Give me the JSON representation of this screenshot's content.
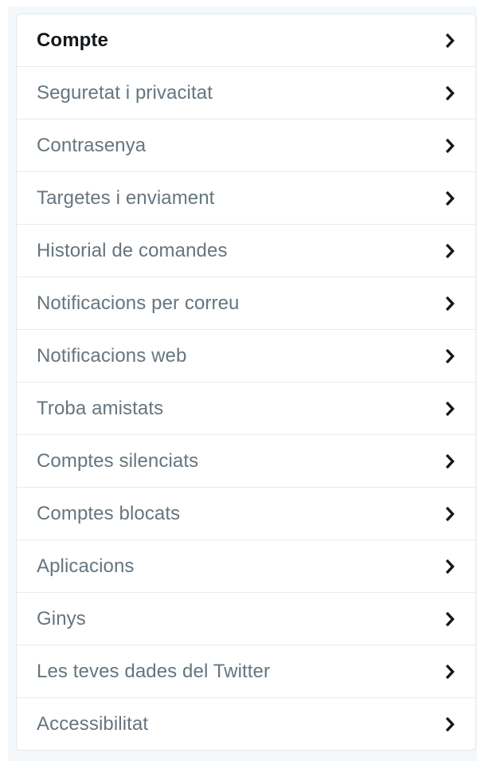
{
  "settings_menu": {
    "items": [
      {
        "label": "Compte",
        "active": true,
        "icon": "chevron-right-icon"
      },
      {
        "label": "Seguretat i privacitat",
        "active": false,
        "icon": "chevron-right-icon"
      },
      {
        "label": "Contrasenya",
        "active": false,
        "icon": "chevron-right-icon"
      },
      {
        "label": "Targetes i enviament",
        "active": false,
        "icon": "chevron-right-icon"
      },
      {
        "label": "Historial de comandes",
        "active": false,
        "icon": "chevron-right-icon"
      },
      {
        "label": "Notificacions per correu",
        "active": false,
        "icon": "chevron-right-icon"
      },
      {
        "label": "Notificacions web",
        "active": false,
        "icon": "chevron-right-icon"
      },
      {
        "label": "Troba amistats",
        "active": false,
        "icon": "chevron-right-icon"
      },
      {
        "label": "Comptes silenciats",
        "active": false,
        "icon": "chevron-right-icon"
      },
      {
        "label": "Comptes blocats",
        "active": false,
        "icon": "chevron-right-icon"
      },
      {
        "label": "Aplicacions",
        "active": false,
        "icon": "chevron-right-icon"
      },
      {
        "label": "Ginys",
        "active": false,
        "icon": "chevron-right-icon"
      },
      {
        "label": "Les teves dades del Twitter",
        "active": false,
        "icon": "chevron-right-icon"
      },
      {
        "label": "Accessibilitat",
        "active": false,
        "icon": "chevron-right-icon"
      }
    ]
  },
  "colors": {
    "text_active": "#14171a",
    "text_default": "#66757f",
    "chevron": "#14171a",
    "border": "#e6ecf0",
    "background": "#f5f8fa"
  }
}
